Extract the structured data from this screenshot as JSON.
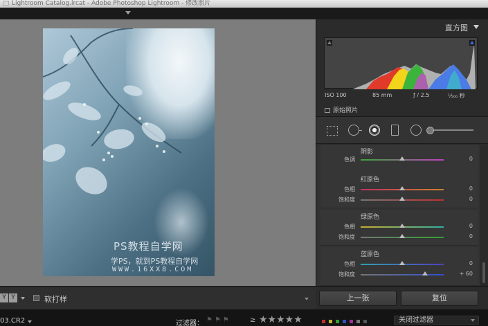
{
  "window": {
    "title": "Lightroom Catalog.lrcat - Adobe Photoshop Lightroom - 修改照片"
  },
  "histogram": {
    "panel_title": "直方图",
    "exif": {
      "iso": "ISO 100",
      "focal": "85 mm",
      "aperture": "ƒ / 2.5",
      "shutter": "¹⁄₅₀₀ 秒"
    },
    "original_photo_label": "原始照片"
  },
  "tools": [
    "crop-icon",
    "spot-removal-icon",
    "red-eye-icon",
    "graduated-filter-icon",
    "radial-filter-icon",
    "adjustment-brush-icon"
  ],
  "adjustments": {
    "groups": [
      {
        "title": "阴影",
        "rows": [
          {
            "label": "色调",
            "value": "0"
          }
        ]
      },
      {
        "title": "红原色",
        "rows": [
          {
            "label": "色相",
            "value": "0"
          },
          {
            "label": "饱和度",
            "value": "0"
          }
        ]
      },
      {
        "title": "绿原色",
        "rows": [
          {
            "label": "色相",
            "value": "0"
          },
          {
            "label": "饱和度",
            "value": "0"
          }
        ]
      },
      {
        "title": "蓝原色",
        "rows": [
          {
            "label": "色相",
            "value": "0"
          },
          {
            "label": "饱和度",
            "value": "+ 60"
          }
        ]
      }
    ]
  },
  "watermark": {
    "line1": "PS教程自学网",
    "line2": "学PS，就到PS教程自学网",
    "line3": "WWW.16XX8.COM"
  },
  "toolbar": {
    "view_mode": "Y|Y",
    "soft_proof_label": "软打样"
  },
  "buttons": {
    "previous": "上一张",
    "reset": "复位"
  },
  "filmstrip": {
    "filename": "03.CR2",
    "filter_label": "过滤器：",
    "rating_operator": "≥",
    "stars": "★★★★★",
    "filter_dropdown": "关闭过滤器"
  },
  "colors": {
    "accent_blue": "#3b6fe0",
    "panel_bg": "#2b2b2b"
  }
}
